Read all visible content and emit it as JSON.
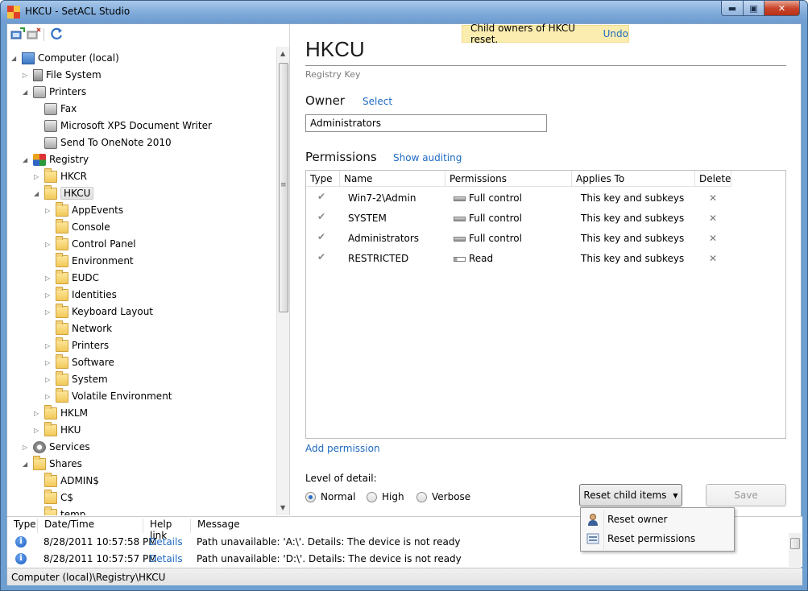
{
  "window": {
    "title": "HKCU - SetACL Studio",
    "min_glyph": "▬",
    "max_glyph": "▣",
    "close_glyph": "✕"
  },
  "toolbar": {
    "icons": [
      "connect-icon",
      "disconnect-icon",
      "refresh-icon"
    ]
  },
  "tree": {
    "nodes": [
      {
        "label": "Computer (local)",
        "expander": "◢",
        "icon": "computer"
      },
      {
        "label": "File System",
        "expander": "▷",
        "icon": "filesys"
      },
      {
        "label": "Printers",
        "expander": "◢",
        "icon": "printer"
      },
      {
        "label": "Fax",
        "expander": "",
        "icon": "printer"
      },
      {
        "label": "Microsoft XPS Document Writer",
        "expander": "",
        "icon": "printer"
      },
      {
        "label": "Send To OneNote 2010",
        "expander": "",
        "icon": "printer"
      },
      {
        "label": "Registry",
        "expander": "◢",
        "icon": "registry"
      },
      {
        "label": "HKCR",
        "expander": "▷",
        "icon": "folder"
      },
      {
        "label": "HKCU",
        "expander": "◢",
        "icon": "folder"
      },
      {
        "label": "AppEvents",
        "expander": "▷",
        "icon": "folder"
      },
      {
        "label": "Console",
        "expander": "",
        "icon": "folder"
      },
      {
        "label": "Control Panel",
        "expander": "▷",
        "icon": "folder"
      },
      {
        "label": "Environment",
        "expander": "",
        "icon": "folder"
      },
      {
        "label": "EUDC",
        "expander": "▷",
        "icon": "folder"
      },
      {
        "label": "Identities",
        "expander": "▷",
        "icon": "folder"
      },
      {
        "label": "Keyboard Layout",
        "expander": "▷",
        "icon": "folder"
      },
      {
        "label": "Network",
        "expander": "",
        "icon": "folder"
      },
      {
        "label": "Printers",
        "expander": "▷",
        "icon": "folder"
      },
      {
        "label": "Software",
        "expander": "▷",
        "icon": "folder"
      },
      {
        "label": "System",
        "expander": "▷",
        "icon": "folder"
      },
      {
        "label": "Volatile Environment",
        "expander": "▷",
        "icon": "folder"
      },
      {
        "label": "HKLM",
        "expander": "▷",
        "icon": "folder"
      },
      {
        "label": "HKU",
        "expander": "▷",
        "icon": "folder"
      },
      {
        "label": "Services",
        "expander": "▷",
        "icon": "gear"
      },
      {
        "label": "Shares",
        "expander": "◢",
        "icon": "folder"
      },
      {
        "label": "ADMIN$",
        "expander": "",
        "icon": "folder"
      },
      {
        "label": "C$",
        "expander": "",
        "icon": "folder"
      },
      {
        "label": "temp",
        "expander": "",
        "icon": "folder"
      }
    ],
    "scroll_up": "▲",
    "scroll_down": "▼",
    "grip": "≡"
  },
  "notification": {
    "text": "Child owners of HKCU reset.",
    "undo": "Undo"
  },
  "detail": {
    "title": "HKCU",
    "subtitle": "Registry Key",
    "owner_label": "Owner",
    "owner_select": "Select",
    "owner_value": "Administrators",
    "permissions_label": "Permissions",
    "show_auditing": "Show auditing",
    "add_permission": "Add permission",
    "level_label": "Level of detail:",
    "levels": [
      "Normal",
      "High",
      "Verbose"
    ],
    "selected_level": "Normal"
  },
  "grid": {
    "headers": [
      "Type",
      "Name",
      "Permissions",
      "Applies To",
      "Delete"
    ],
    "rows": [
      {
        "type": "✔",
        "name": "Win7-2\\Admin",
        "perm": "Full control",
        "perm_kind": "full",
        "applies": "This key and subkeys",
        "delete": "✕"
      },
      {
        "type": "✔",
        "name": "SYSTEM",
        "perm": "Full control",
        "perm_kind": "full",
        "applies": "This key and subkeys",
        "delete": "✕"
      },
      {
        "type": "✔",
        "name": "Administrators",
        "perm": "Full control",
        "perm_kind": "full",
        "applies": "This key and subkeys",
        "delete": "✕"
      },
      {
        "type": "✔",
        "name": "RESTRICTED",
        "perm": "Read",
        "perm_kind": "read",
        "applies": "This key and subkeys",
        "delete": "✕"
      }
    ]
  },
  "buttons": {
    "reset_child": "Reset child items",
    "reset_arrow": "▼",
    "save": "Save"
  },
  "menu": {
    "items": [
      "Reset owner",
      "Reset permissions"
    ]
  },
  "log": {
    "headers": [
      "Type",
      "Date/Time",
      "Help link",
      "Message"
    ],
    "rows": [
      {
        "type": "i",
        "datetime": "8/28/2011 10:57:58 PM",
        "link": "Details",
        "message": "Path unavailable: 'A:\\'. Details: The device is not ready"
      },
      {
        "type": "i",
        "datetime": "8/28/2011 10:57:57 PM",
        "link": "Details",
        "message": "Path unavailable: 'D:\\'. Details: The device is not ready"
      }
    ]
  },
  "status": {
    "path": "Computer (local)\\Registry\\HKCU"
  }
}
